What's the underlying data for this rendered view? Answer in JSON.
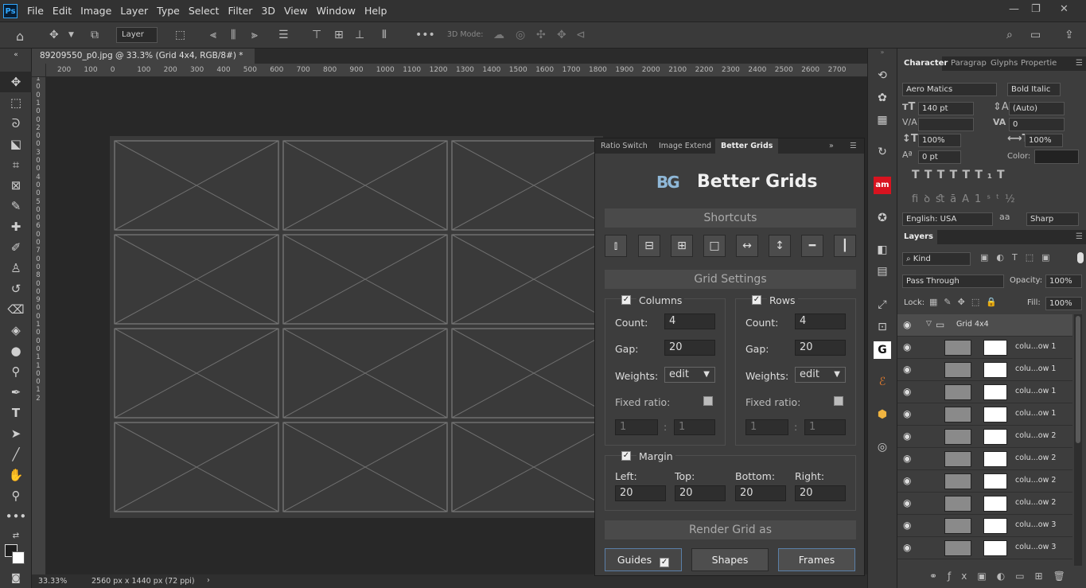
{
  "app": {
    "logo": "Ps",
    "menus": [
      "File",
      "Edit",
      "Image",
      "Layer",
      "Type",
      "Select",
      "Filter",
      "3D",
      "View",
      "Window",
      "Help"
    ]
  },
  "options": {
    "layer_select": "Layer",
    "mode_3d": "3D Mode:"
  },
  "document": {
    "tab_title": "89209550_p0.jpg @ 33.3% (Grid 4x4, RGB/8#) *",
    "close": "×"
  },
  "ruler": {
    "top": [
      "200",
      "100",
      "0",
      "100",
      "200",
      "300",
      "400",
      "500",
      "600",
      "700",
      "800",
      "900",
      "1000",
      "1100",
      "1200",
      "1300",
      "1400",
      "1500",
      "1600",
      "1700",
      "1800",
      "1900",
      "2000",
      "2100",
      "2200",
      "2300",
      "2400",
      "2500",
      "2600",
      "2700"
    ],
    "left": [
      "1",
      "0",
      "0",
      "1",
      "0",
      "0",
      "2",
      "0",
      "0",
      "3",
      "0",
      "0",
      "4",
      "0",
      "0",
      "5",
      "0",
      "0",
      "6",
      "0",
      "0",
      "7",
      "0",
      "0",
      "8",
      "0",
      "0",
      "9",
      "0",
      "0",
      "1",
      "0",
      "0",
      "0",
      "1",
      "1",
      "0",
      "0",
      "1",
      "2"
    ]
  },
  "status": {
    "zoom": "33.33%",
    "size": "2560 px x 1440 px (72 ppi)"
  },
  "better_grids": {
    "tabs": [
      "Ratio Switch",
      "Image Extend",
      "Better Grids"
    ],
    "title": "Better Grids",
    "logo": "BG",
    "shortcuts_title": "Shortcuts",
    "settings_title": "Grid Settings",
    "columns": {
      "label": "Columns",
      "count_label": "Count:",
      "count": "4",
      "gap_label": "Gap:",
      "gap": "20",
      "weights_label": "Weights:",
      "weights": "edit",
      "fixed_label": "Fixed ratio:",
      "ratio_a": "1",
      "ratio_b": "1",
      "sep": ":"
    },
    "rows": {
      "label": "Rows",
      "count_label": "Count:",
      "count": "4",
      "gap_label": "Gap:",
      "gap": "20",
      "weights_label": "Weights:",
      "weights": "edit",
      "fixed_label": "Fixed ratio:",
      "ratio_a": "1",
      "ratio_b": "1",
      "sep": ":"
    },
    "margin": {
      "label": "Margin",
      "left_label": "Left:",
      "left": "20",
      "top_label": "Top:",
      "top": "20",
      "bottom_label": "Bottom:",
      "bottom": "20",
      "right_label": "Right:",
      "right": "20"
    },
    "render_title": "Render Grid as",
    "render": {
      "guides": "Guides",
      "shapes": "Shapes",
      "frames": "Frames"
    }
  },
  "character": {
    "tabs": [
      "Character",
      "Paragrap",
      "Glyphs",
      "Propertie"
    ],
    "font": "Aero Matics",
    "style": "Bold Italic",
    "size": "140 pt",
    "leading": "(Auto)",
    "kerning": "",
    "tracking": "0",
    "vscale": "100%",
    "hscale": "100%",
    "baseline": "0 pt",
    "color_label": "Color:",
    "language": "English: USA",
    "aa_label": "aa",
    "antialias": "Sharp"
  },
  "layers": {
    "title": "Layers",
    "kind": "Kind",
    "blend": "Pass Through",
    "opacity_label": "Opacity:",
    "opacity": "100%",
    "lock_label": "Lock:",
    "fill_label": "Fill:",
    "fill": "100%",
    "group": "Grid 4x4",
    "items": [
      "colu...ow 1",
      "colu...ow 1",
      "colu...ow 1",
      "colu...ow 1",
      "colu...ow 2",
      "colu...ow 2",
      "colu...ow 2",
      "colu...ow 2",
      "colu...ow 3",
      "colu...ow 3"
    ]
  }
}
